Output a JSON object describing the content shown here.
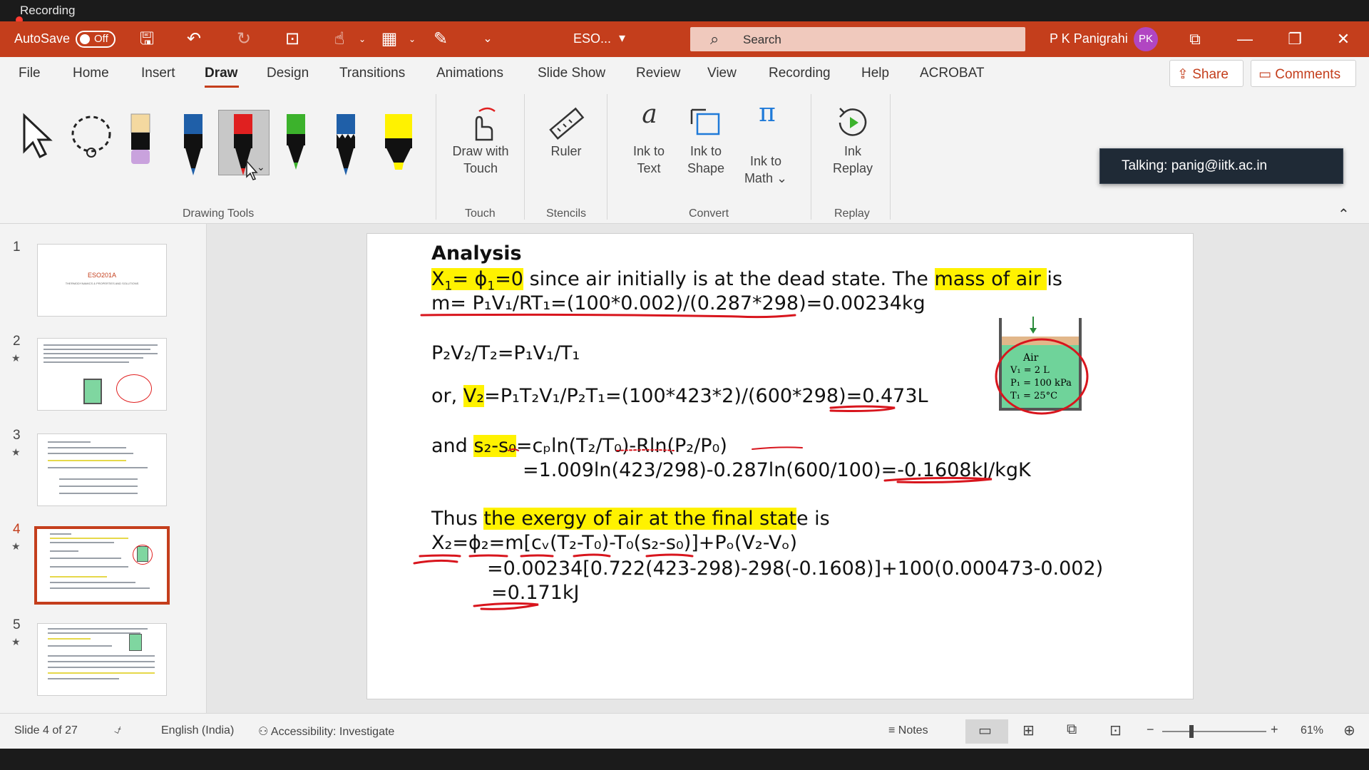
{
  "recording": {
    "label": "Recording"
  },
  "titlebar": {
    "autosave_label": "AutoSave",
    "autosave_state": "Off",
    "file_name": "ESO...",
    "search_placeholder": "Search",
    "user_name": "P K Panigrahi",
    "user_initials": "PK",
    "accent": "#c43e1c"
  },
  "tabs": [
    "File",
    "Home",
    "Insert",
    "Draw",
    "Design",
    "Transitions",
    "Animations",
    "Slide Show",
    "Review",
    "View",
    "Recording",
    "Help",
    "ACROBAT"
  ],
  "active_tab": "Draw",
  "header_buttons": {
    "share": "Share",
    "comments": "Comments"
  },
  "ribbon": {
    "groups": {
      "drawing_tools": "Drawing Tools",
      "touch": "Touch",
      "stencils": "Stencils",
      "convert": "Convert",
      "replay": "Replay"
    },
    "draw_with_touch": [
      "Draw with",
      "Touch"
    ],
    "ruler": "Ruler",
    "ink_to_text": [
      "Ink to",
      "Text"
    ],
    "ink_to_shape": [
      "Ink to",
      "Shape"
    ],
    "ink_to_math": [
      "Ink to",
      "Math ⌄"
    ],
    "ink_replay": [
      "Ink",
      "Replay"
    ],
    "pens": [
      {
        "name": "select-tool",
        "color": "#333333"
      },
      {
        "name": "lasso-select",
        "color": "#333333"
      },
      {
        "name": "eraser",
        "color": "#f4d9a0"
      },
      {
        "name": "pen-blue",
        "color": "#1f5fa8"
      },
      {
        "name": "pen-red",
        "color": "#e02020"
      },
      {
        "name": "pen-green",
        "color": "#3cb22c"
      },
      {
        "name": "pen-blue-galaxy",
        "color": "#1f5fa8"
      },
      {
        "name": "highlighter-yellow",
        "color": "#fff200"
      }
    ]
  },
  "talking_badge": "Talking: panig@iitk.ac.in",
  "thumbnails": [
    {
      "num": "1",
      "title": "ESO201A",
      "sub": "THERMODYNAMICS & PROPERTIES AND SOLUTIONS"
    },
    {
      "num": "2",
      "star": "★"
    },
    {
      "num": "3",
      "star": "★"
    },
    {
      "num": "4",
      "star": "★"
    },
    {
      "num": "5",
      "star": "★"
    }
  ],
  "slide": {
    "heading": "Analysis",
    "l1_a": "X",
    "l1_b": "1",
    "l1_c": "= ϕ",
    "l1_d": "1",
    "l1_e": "=0",
    "l1_f": " since air initially is at the ",
    "l1_g": "dead state. The ",
    "l1_h": "mass of air ",
    "l1_i": "is",
    "l2": "m= P₁V₁/RT₁=(100*0.002)/(0.287*298)=0.00234kg",
    "l3": "P₂V₂/T₂=P₁V₁/T₁",
    "l4_a": "or, ",
    "l4_b": "V₂",
    "l4_c": "=P₁T₂V₁/P₂T₁=(100*423*2)/(600*298)=0.473L",
    "l5_a": "and ",
    "l5_b": "s₂-s₀",
    "l5_c": "=cₚln(T₂/T₀)-Rln(P₂/P₀)",
    "l6": "=1.009ln(423/298)-0.287ln(600/100)=-0.1608kJ/kgK",
    "l7_a": "Thus ",
    "l7_b": "the exergy of air at the final stat",
    "l7_c": "e is",
    "l8": "X₂=ϕ₂=m[cᵥ(T₂-T₀)-T₀(s₂-s₀)]+Pₒ(V₂-Vₒ)",
    "l9": "=0.00234[0.722(423-298)-298(-0.1608)]+100(0.000473-0.002)",
    "l10": "=0.171kJ",
    "figure": {
      "label": "Air",
      "v1": "V₁ = 2 L",
      "p1": "P₁ = 100 kPa",
      "t1": "T₁ = 25°C"
    }
  },
  "status": {
    "slide_info": "Slide 4 of 27",
    "language": "English (India)",
    "accessibility": "Accessibility: Investigate",
    "notes": "Notes",
    "zoom": "61%"
  }
}
